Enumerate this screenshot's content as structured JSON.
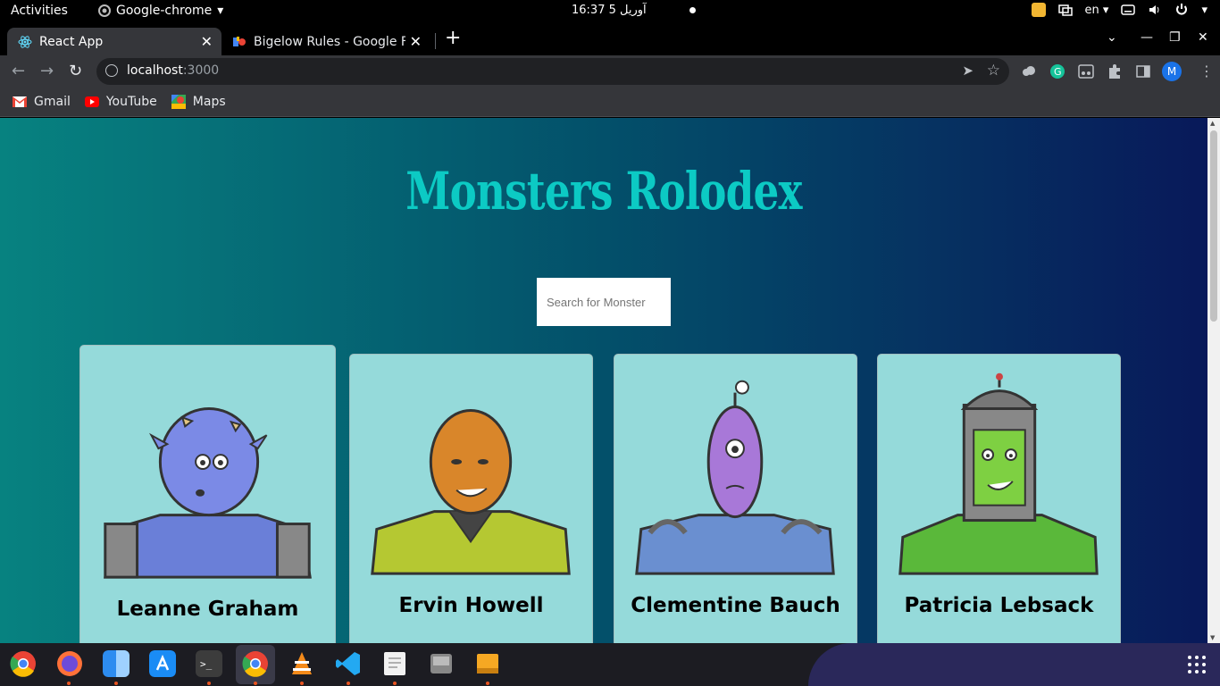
{
  "system": {
    "activities": "Activities",
    "app_menu": "Google-chrome",
    "clock": "16:37  5 آوریل",
    "keyboard_layout": "en"
  },
  "browser": {
    "tabs": [
      {
        "title": "React App",
        "active": true
      },
      {
        "title": "Bigelow Rules - Google Fo",
        "active": false
      }
    ],
    "url_host": "localhost",
    "url_port": ":3000",
    "profile_initial": "M",
    "bookmarks": [
      "Gmail",
      "YouTube",
      "Maps"
    ]
  },
  "page": {
    "title": "Monsters Rolodex",
    "search_placeholder": "Search for Monster",
    "monsters": [
      {
        "name": "Leanne Graham",
        "skin": "#7b8ae6",
        "body": "#6a7fd8"
      },
      {
        "name": "Ervin Howell",
        "skin": "#d9862a",
        "body": "#b5c832"
      },
      {
        "name": "Clementine Bauch",
        "skin": "#a878d8",
        "body": "#6a8fd0"
      },
      {
        "name": "Patricia Lebsack",
        "skin": "#7ed042",
        "body": "#5ab83a"
      }
    ]
  },
  "colors": {
    "title": "#0ccac4",
    "card": "#95dada"
  },
  "dock": [
    "chrome",
    "firefox",
    "finder",
    "app-store",
    "terminal",
    "chrome-active",
    "vlc",
    "vscode",
    "text-editor",
    "disk",
    "archive"
  ]
}
